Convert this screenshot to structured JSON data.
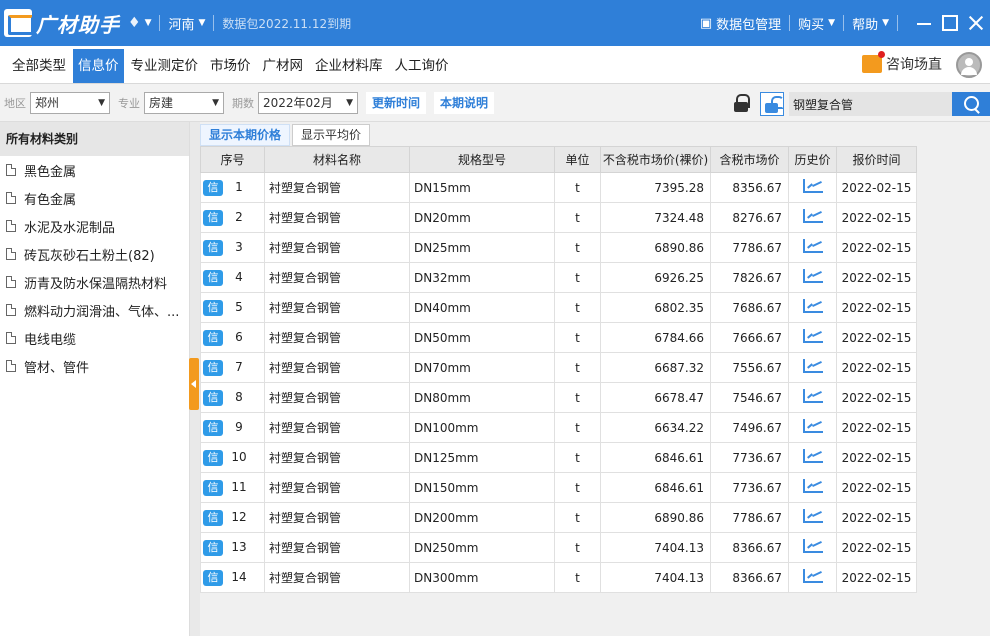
{
  "app": {
    "title": "广材助手",
    "region": "河南",
    "package_info": "数据包2022.11.12到期",
    "pkg_manage": "数据包管理",
    "buy": "购买",
    "help": "帮助"
  },
  "nav": {
    "tabs": [
      "全部类型",
      "信息价",
      "专业测定价",
      "市场价",
      "广材网",
      "企业材料库",
      "人工询价"
    ],
    "active_index": 1,
    "consult": "咨询场直"
  },
  "filters": {
    "region_label": "地区",
    "region_value": "郑州",
    "major_label": "专业",
    "major_value": "房建",
    "period_label": "期数",
    "period_value": "2022年02月",
    "update_time": "更新时间",
    "period_note": "本期说明",
    "search_value": "钢塑复合管"
  },
  "sidebar": {
    "title": "所有材料类别",
    "items": [
      "黑色金属",
      "有色金属",
      "水泥及水泥制品",
      "砖瓦灰砂石土粉土(82)",
      "沥青及防水保温隔热材料",
      "燃料动力润滑油、气体、...",
      "电线电缆",
      "管材、管件"
    ]
  },
  "subtabs": [
    "显示本期价格",
    "显示平均价"
  ],
  "table": {
    "headers": [
      "序号",
      "材料名称",
      "规格型号",
      "单位",
      "不含税市场价(裸价)",
      "含税市场价",
      "历史价",
      "报价时间"
    ],
    "badge": "信",
    "rows": [
      {
        "no": "1",
        "name": "衬塑复合钢管",
        "spec": "DN15mm",
        "unit": "t",
        "price_ex": "7395.28",
        "price_in": "8356.67",
        "date": "2022-02-15"
      },
      {
        "no": "2",
        "name": "衬塑复合钢管",
        "spec": "DN20mm",
        "unit": "t",
        "price_ex": "7324.48",
        "price_in": "8276.67",
        "date": "2022-02-15"
      },
      {
        "no": "3",
        "name": "衬塑复合钢管",
        "spec": "DN25mm",
        "unit": "t",
        "price_ex": "6890.86",
        "price_in": "7786.67",
        "date": "2022-02-15"
      },
      {
        "no": "4",
        "name": "衬塑复合钢管",
        "spec": "DN32mm",
        "unit": "t",
        "price_ex": "6926.25",
        "price_in": "7826.67",
        "date": "2022-02-15"
      },
      {
        "no": "5",
        "name": "衬塑复合钢管",
        "spec": "DN40mm",
        "unit": "t",
        "price_ex": "6802.35",
        "price_in": "7686.67",
        "date": "2022-02-15"
      },
      {
        "no": "6",
        "name": "衬塑复合钢管",
        "spec": "DN50mm",
        "unit": "t",
        "price_ex": "6784.66",
        "price_in": "7666.67",
        "date": "2022-02-15"
      },
      {
        "no": "7",
        "name": "衬塑复合钢管",
        "spec": "DN70mm",
        "unit": "t",
        "price_ex": "6687.32",
        "price_in": "7556.67",
        "date": "2022-02-15"
      },
      {
        "no": "8",
        "name": "衬塑复合钢管",
        "spec": "DN80mm",
        "unit": "t",
        "price_ex": "6678.47",
        "price_in": "7546.67",
        "date": "2022-02-15"
      },
      {
        "no": "9",
        "name": "衬塑复合钢管",
        "spec": "DN100mm",
        "unit": "t",
        "price_ex": "6634.22",
        "price_in": "7496.67",
        "date": "2022-02-15"
      },
      {
        "no": "10",
        "name": "衬塑复合钢管",
        "spec": "DN125mm",
        "unit": "t",
        "price_ex": "6846.61",
        "price_in": "7736.67",
        "date": "2022-02-15"
      },
      {
        "no": "11",
        "name": "衬塑复合钢管",
        "spec": "DN150mm",
        "unit": "t",
        "price_ex": "6846.61",
        "price_in": "7736.67",
        "date": "2022-02-15"
      },
      {
        "no": "12",
        "name": "衬塑复合钢管",
        "spec": "DN200mm",
        "unit": "t",
        "price_ex": "6890.86",
        "price_in": "7786.67",
        "date": "2022-02-15"
      },
      {
        "no": "13",
        "name": "衬塑复合钢管",
        "spec": "DN250mm",
        "unit": "t",
        "price_ex": "7404.13",
        "price_in": "8366.67",
        "date": "2022-02-15"
      },
      {
        "no": "14",
        "name": "衬塑复合钢管",
        "spec": "DN300mm",
        "unit": "t",
        "price_ex": "7404.13",
        "price_in": "8366.67",
        "date": "2022-02-15"
      }
    ]
  },
  "colors": {
    "primary": "#2f7fd8",
    "accent": "#f39a1e",
    "badge": "#2f9be8"
  }
}
